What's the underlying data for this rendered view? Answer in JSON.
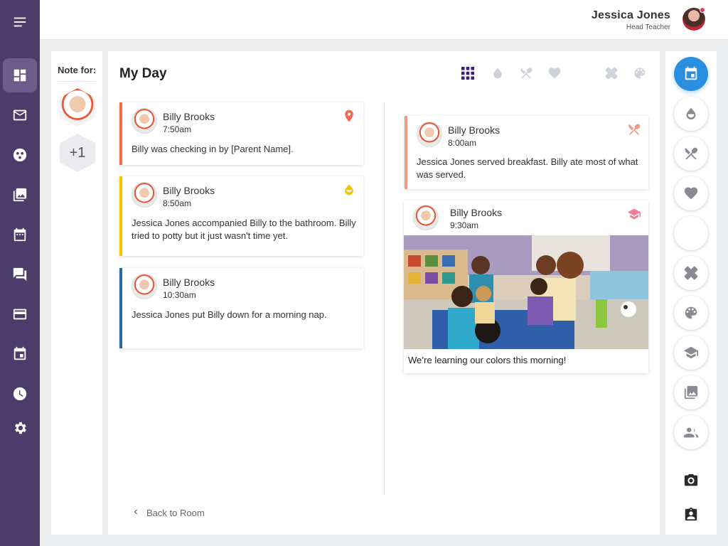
{
  "header": {
    "user_name": "Jessica Jones",
    "user_role": "Head Teacher"
  },
  "nav": {
    "items": [
      "menu-icon",
      "dashboard-icon",
      "mail-icon",
      "classes-icon",
      "photos-icon",
      "calendar-icon",
      "chat-icon",
      "billing-icon",
      "events-icon",
      "clock-icon",
      "settings-icon"
    ],
    "active": "dashboard-icon"
  },
  "note_for": {
    "label": "Note for:",
    "more_count": "+1"
  },
  "main": {
    "title": "My Day",
    "filters": [
      "grid-icon",
      "potty-icon",
      "meal-icon",
      "health-icon",
      "nap-icon",
      "first-aid-icon",
      "art-icon"
    ],
    "left_cards": [
      {
        "name": "Billy Brooks",
        "time": "7:50am",
        "text": "Billy was checking in by [Parent Name].",
        "icon": "location-pin-icon",
        "color": "#f26b4f"
      },
      {
        "name": "Billy Brooks",
        "time": "8:50am",
        "text": "Jessica Jones accompanied Billy to the bathroom. Billy tried to potty but it just wasn't time yet.",
        "icon": "potty-icon",
        "color": "#f5c400"
      },
      {
        "name": "Billy Brooks",
        "time": "10:30am",
        "text": "Jessica Jones put Billy down for a morning nap.",
        "icon": "nap-icon",
        "color": "#2d6a98"
      }
    ],
    "right_cards": [
      {
        "name": "Billy Brooks",
        "time": "8:00am",
        "text": "Jessica Jones served breakfast. Billy ate most of what was served.",
        "icon": "meal-icon",
        "color": "#f29a86"
      },
      {
        "name": "Billy Brooks",
        "time": "9:30am",
        "caption": "We’re learning our colors this morning!",
        "icon": "learning-icon",
        "color": "#f27d93"
      }
    ],
    "back_label": "Back to Room"
  },
  "rail": {
    "buttons": [
      "calendar-icon",
      "potty-icon",
      "meal-icon",
      "health-icon",
      "nap-icon",
      "first-aid-icon",
      "art-icon",
      "learning-icon",
      "photos-icon",
      "people-icon",
      "camera-icon",
      "clipboard-icon"
    ],
    "active": "calendar-icon",
    "accent": "#2b8fe0"
  }
}
